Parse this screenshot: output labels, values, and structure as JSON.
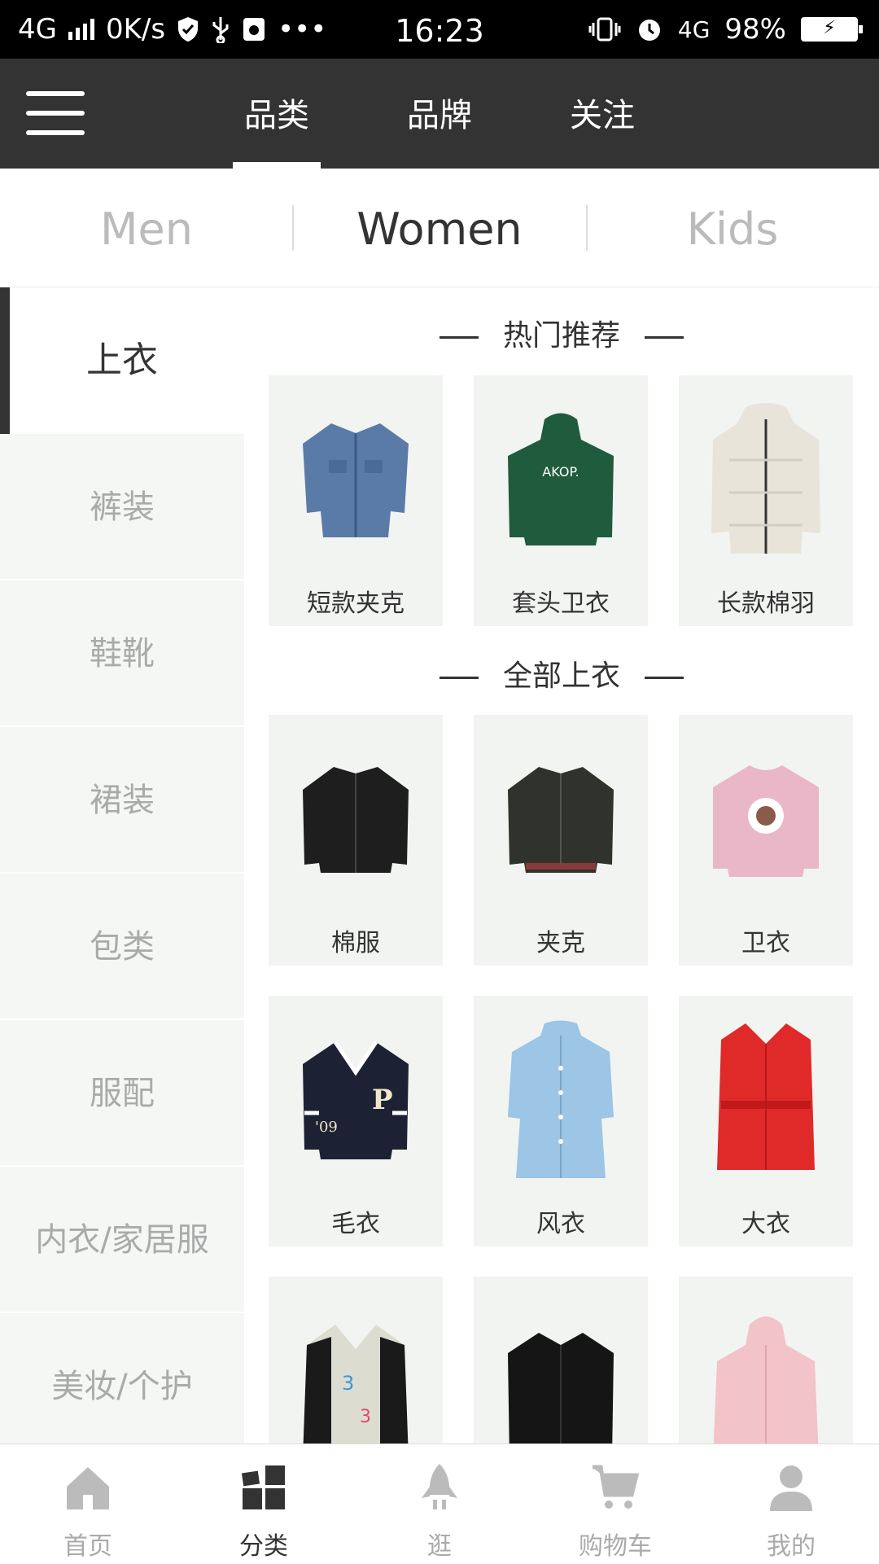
{
  "status_bar": {
    "network": "4G",
    "speed": "0K/s",
    "time": "16:23",
    "network_right": "4G",
    "battery": "98%"
  },
  "top_tabs": [
    {
      "label": "品类",
      "active": true
    },
    {
      "label": "品牌",
      "active": false
    },
    {
      "label": "关注",
      "active": false
    }
  ],
  "gender_tabs": [
    {
      "label": "Men",
      "active": false
    },
    {
      "label": "Women",
      "active": true
    },
    {
      "label": "Kids",
      "active": false
    }
  ],
  "sidebar": {
    "items": [
      {
        "label": "上衣",
        "active": true
      },
      {
        "label": "裤装"
      },
      {
        "label": "鞋靴"
      },
      {
        "label": "裙装"
      },
      {
        "label": "包类"
      },
      {
        "label": "服配"
      },
      {
        "label": "内衣/家居服"
      },
      {
        "label": "美妆/个护"
      }
    ]
  },
  "content": {
    "hot_title": "热门推荐",
    "hot_items": [
      {
        "label": "短款夹克",
        "icon": "denim-jacket-image",
        "color": "#5a7aa8"
      },
      {
        "label": "套头卫衣",
        "icon": "green-hoodie-image",
        "color": "#1f5b3d"
      },
      {
        "label": "长款棉羽",
        "icon": "white-puffer-coat-image",
        "color": "#e8e4da"
      }
    ],
    "all_title": "全部上衣",
    "all_items": [
      {
        "label": "棉服",
        "icon": "black-bomber-image",
        "color": "#1e1e1e"
      },
      {
        "label": "夹克",
        "icon": "leather-bomber-image",
        "color": "#2f332b"
      },
      {
        "label": "卫衣",
        "icon": "pink-sweatshirt-image",
        "color": "#eab7c8"
      },
      {
        "label": "毛衣",
        "icon": "varsity-sweater-image",
        "color": "#1c2233"
      },
      {
        "label": "风衣",
        "icon": "blue-trench-coat-image",
        "color": "#9cc5e6"
      },
      {
        "label": "大衣",
        "icon": "red-coat-image",
        "color": "#e02a2a"
      },
      {
        "label": "",
        "icon": "patterned-cardigan-image",
        "color": "#dcdcd0"
      },
      {
        "label": "",
        "icon": "black-leather-jacket-image",
        "color": "#151515"
      },
      {
        "label": "",
        "icon": "pink-anorak-image",
        "color": "#f2c3c8"
      }
    ]
  },
  "bottom_nav": [
    {
      "label": "首页",
      "icon": "home-icon",
      "active": false
    },
    {
      "label": "分类",
      "icon": "category-icon",
      "active": true
    },
    {
      "label": "逛",
      "icon": "rocket-icon",
      "active": false
    },
    {
      "label": "购物车",
      "icon": "cart-icon",
      "active": false
    },
    {
      "label": "我的",
      "icon": "profile-icon",
      "active": false
    }
  ]
}
